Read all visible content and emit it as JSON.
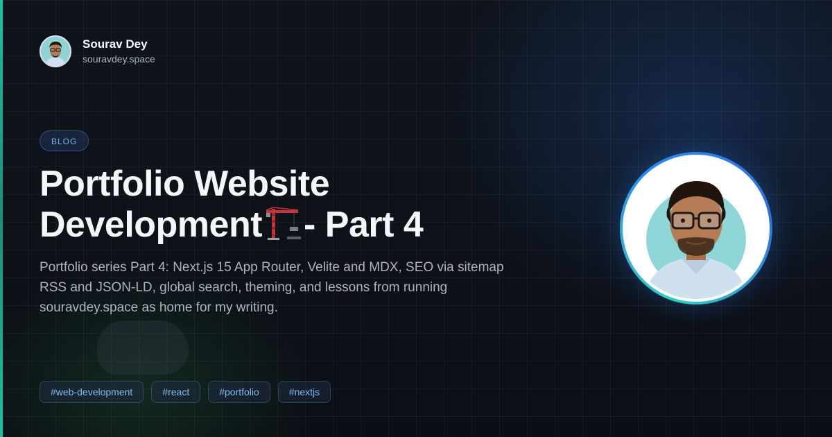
{
  "author": {
    "name": "Sourav Dey",
    "site": "souravdey.space"
  },
  "badge": "BLOG",
  "title": {
    "line1": "Portfolio Website",
    "line2_before": "Development",
    "line2_after": "- Part 4",
    "emoji_icon": "construction-crane-icon"
  },
  "description": "Portfolio series Part 4: Next.js 15 App Router, Velite and MDX, SEO via sitemap RSS and JSON-LD, global search, theming, and lessons from running souravdey.space as home for my writing.",
  "tags": [
    "#web-development",
    "#react",
    "#portfolio",
    "#nextjs"
  ],
  "colors": {
    "accent_bar": "#19c2a0",
    "tag_text": "#86b6f3",
    "badge_text": "#7fb2f2",
    "avatar_ring_start": "#2fd0c4",
    "avatar_ring_end": "#2a8cf0"
  }
}
